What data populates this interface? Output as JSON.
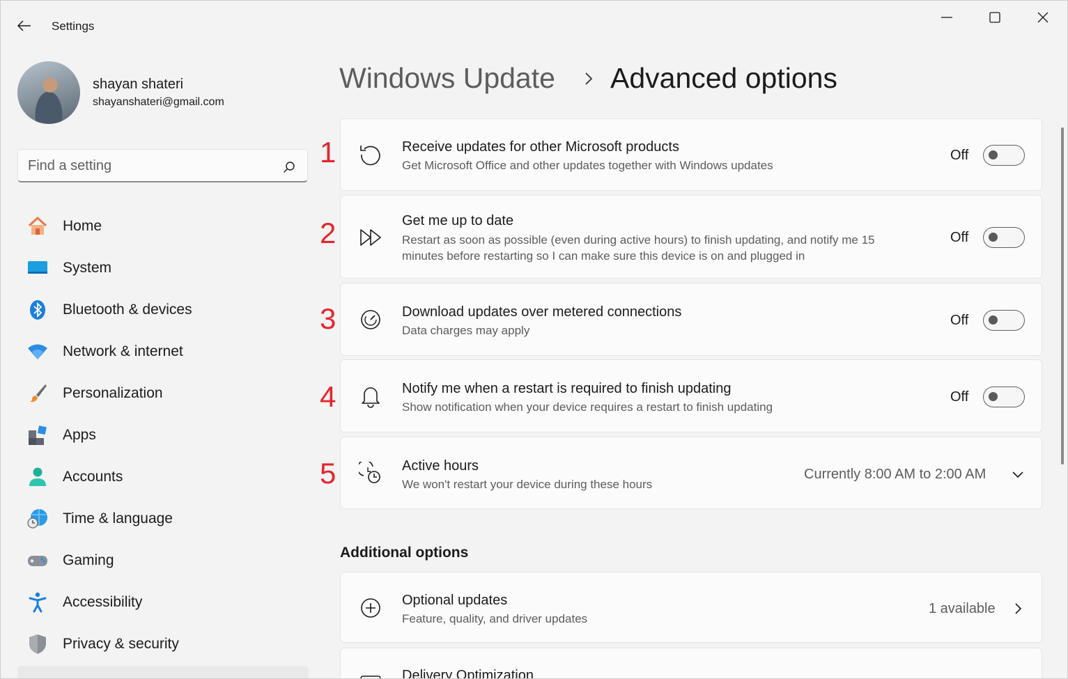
{
  "window": {
    "app_title": "Settings"
  },
  "profile": {
    "name": "shayan shateri",
    "email": "shayanshateri@gmail.com"
  },
  "search": {
    "placeholder": "Find a setting"
  },
  "sidebar": {
    "items": [
      {
        "label": "Home",
        "icon": "home-icon"
      },
      {
        "label": "System",
        "icon": "system-icon"
      },
      {
        "label": "Bluetooth & devices",
        "icon": "bluetooth-icon"
      },
      {
        "label": "Network & internet",
        "icon": "wifi-icon"
      },
      {
        "label": "Personalization",
        "icon": "brush-icon"
      },
      {
        "label": "Apps",
        "icon": "apps-icon"
      },
      {
        "label": "Accounts",
        "icon": "account-icon"
      },
      {
        "label": "Time & language",
        "icon": "globe-clock-icon"
      },
      {
        "label": "Gaming",
        "icon": "gamepad-icon"
      },
      {
        "label": "Accessibility",
        "icon": "accessibility-icon"
      },
      {
        "label": "Privacy & security",
        "icon": "shield-icon"
      }
    ]
  },
  "breadcrumb": {
    "parent": "Windows Update",
    "separator": ">",
    "current": "Advanced options"
  },
  "settings": [
    {
      "marker": "1",
      "title": "Receive updates for other Microsoft products",
      "desc": "Get Microsoft Office and other updates together with Windows updates",
      "state": "Off",
      "icon": "refresh-icon"
    },
    {
      "marker": "2",
      "title": "Get me up to date",
      "desc": "Restart as soon as possible (even during active hours) to finish updating, and notify me 15 minutes before restarting so I can make sure this device is on and plugged in",
      "state": "Off",
      "icon": "fast-forward-icon"
    },
    {
      "marker": "3",
      "title": "Download updates over metered connections",
      "desc": "Data charges may apply",
      "state": "Off",
      "icon": "gauge-icon"
    },
    {
      "marker": "4",
      "title": "Notify me when a restart is required to finish updating",
      "desc": "Show notification when your device requires a restart to finish updating",
      "state": "Off",
      "icon": "bell-icon"
    },
    {
      "marker": "5",
      "title": "Active hours",
      "desc": "We won't restart your device during these hours",
      "value": "Currently 8:00 AM to 2:00 AM",
      "icon": "active-hours-icon"
    }
  ],
  "additional": {
    "heading": "Additional options",
    "items": [
      {
        "title": "Optional updates",
        "desc": "Feature, quality, and driver updates",
        "value": "1 available",
        "icon": "plus-circle-icon"
      },
      {
        "title": "Delivery Optimization",
        "icon": "delivery-icon"
      }
    ]
  },
  "colors": {
    "annotation": "#e3262f",
    "background": "#f3f3f3",
    "card": "#fbfbfb"
  }
}
